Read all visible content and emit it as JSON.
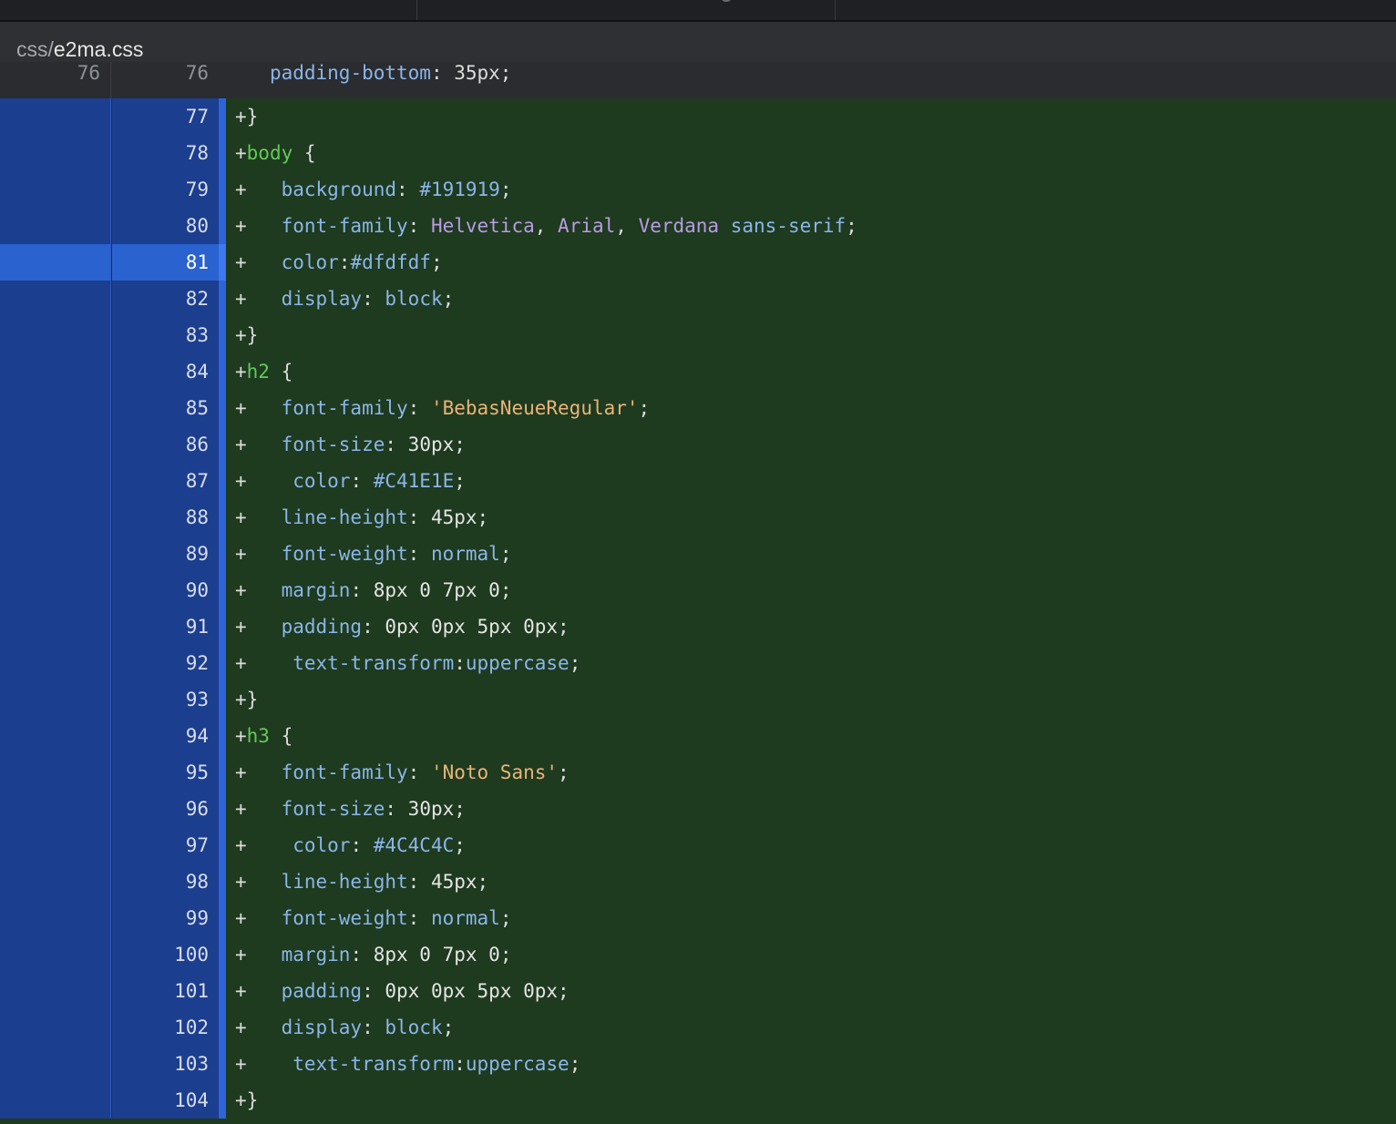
{
  "file": {
    "dir": "css/",
    "name": "e2ma.css"
  },
  "context_line": {
    "old_num": "76",
    "new_num": "76",
    "prefix": "   ",
    "property": "padding-bottom",
    "rest": ": 35px;"
  },
  "lines": [
    {
      "n": "77",
      "segs": [
        [
          "p",
          "+}"
        ]
      ]
    },
    {
      "n": "78",
      "segs": [
        [
          "p",
          "+"
        ],
        [
          "s",
          "body"
        ],
        [
          "p",
          " {"
        ]
      ]
    },
    {
      "n": "79",
      "segs": [
        [
          "p",
          "+   "
        ],
        [
          "k",
          "background"
        ],
        [
          "p",
          ": "
        ],
        [
          "v",
          "#191919"
        ],
        [
          "p",
          ";"
        ]
      ]
    },
    {
      "n": "80",
      "segs": [
        [
          "p",
          "+   "
        ],
        [
          "k",
          "font-family"
        ],
        [
          "p",
          ": "
        ],
        [
          "f",
          "Helvetica"
        ],
        [
          "p",
          ", "
        ],
        [
          "f",
          "Arial"
        ],
        [
          "p",
          ", "
        ],
        [
          "f",
          "Verdana"
        ],
        [
          "p",
          " "
        ],
        [
          "v",
          "sans-serif"
        ],
        [
          "p",
          ";"
        ]
      ]
    },
    {
      "n": "81",
      "sel": true,
      "segs": [
        [
          "p",
          "+   "
        ],
        [
          "k",
          "color"
        ],
        [
          "p",
          ":"
        ],
        [
          "v",
          "#dfdfdf"
        ],
        [
          "p",
          ";"
        ]
      ]
    },
    {
      "n": "82",
      "segs": [
        [
          "p",
          "+   "
        ],
        [
          "k",
          "display"
        ],
        [
          "p",
          ": "
        ],
        [
          "v",
          "block"
        ],
        [
          "p",
          ";"
        ]
      ]
    },
    {
      "n": "83",
      "segs": [
        [
          "p",
          "+}"
        ]
      ]
    },
    {
      "n": "84",
      "segs": [
        [
          "p",
          "+"
        ],
        [
          "s",
          "h2"
        ],
        [
          "p",
          " {"
        ]
      ]
    },
    {
      "n": "85",
      "segs": [
        [
          "p",
          "+   "
        ],
        [
          "k",
          "font-family"
        ],
        [
          "p",
          ": "
        ],
        [
          "str",
          "'BebasNeueRegular'"
        ],
        [
          "p",
          ";"
        ]
      ]
    },
    {
      "n": "86",
      "segs": [
        [
          "p",
          "+   "
        ],
        [
          "k",
          "font-size"
        ],
        [
          "p",
          ": "
        ],
        [
          "n",
          "30px"
        ],
        [
          "p",
          ";"
        ]
      ]
    },
    {
      "n": "87",
      "segs": [
        [
          "p",
          "+    "
        ],
        [
          "k",
          "color"
        ],
        [
          "p",
          ": "
        ],
        [
          "v",
          "#C41E1E"
        ],
        [
          "p",
          ";"
        ]
      ]
    },
    {
      "n": "88",
      "segs": [
        [
          "p",
          "+   "
        ],
        [
          "k",
          "line-height"
        ],
        [
          "p",
          ": "
        ],
        [
          "n",
          "45px"
        ],
        [
          "p",
          ";"
        ]
      ]
    },
    {
      "n": "89",
      "segs": [
        [
          "p",
          "+   "
        ],
        [
          "k",
          "font-weight"
        ],
        [
          "p",
          ": "
        ],
        [
          "v",
          "normal"
        ],
        [
          "p",
          ";"
        ]
      ]
    },
    {
      "n": "90",
      "segs": [
        [
          "p",
          "+   "
        ],
        [
          "k",
          "margin"
        ],
        [
          "p",
          ": "
        ],
        [
          "n",
          "8px 0 7px 0"
        ],
        [
          "p",
          ";"
        ]
      ]
    },
    {
      "n": "91",
      "segs": [
        [
          "p",
          "+   "
        ],
        [
          "k",
          "padding"
        ],
        [
          "p",
          ": "
        ],
        [
          "n",
          "0px 0px 5px 0px"
        ],
        [
          "p",
          ";"
        ]
      ]
    },
    {
      "n": "92",
      "segs": [
        [
          "p",
          "+    "
        ],
        [
          "k",
          "text-transform"
        ],
        [
          "p",
          ":"
        ],
        [
          "v",
          "uppercase"
        ],
        [
          "p",
          ";"
        ]
      ]
    },
    {
      "n": "93",
      "segs": [
        [
          "p",
          "+}"
        ]
      ]
    },
    {
      "n": "94",
      "segs": [
        [
          "p",
          "+"
        ],
        [
          "s",
          "h3"
        ],
        [
          "p",
          " {"
        ]
      ]
    },
    {
      "n": "95",
      "segs": [
        [
          "p",
          "+   "
        ],
        [
          "k",
          "font-family"
        ],
        [
          "p",
          ": "
        ],
        [
          "str",
          "'Noto Sans'"
        ],
        [
          "p",
          ";"
        ]
      ]
    },
    {
      "n": "96",
      "segs": [
        [
          "p",
          "+   "
        ],
        [
          "k",
          "font-size"
        ],
        [
          "p",
          ": "
        ],
        [
          "n",
          "30px"
        ],
        [
          "p",
          ";"
        ]
      ]
    },
    {
      "n": "97",
      "segs": [
        [
          "p",
          "+    "
        ],
        [
          "k",
          "color"
        ],
        [
          "p",
          ": "
        ],
        [
          "v",
          "#4C4C4C"
        ],
        [
          "p",
          ";"
        ]
      ]
    },
    {
      "n": "98",
      "segs": [
        [
          "p",
          "+   "
        ],
        [
          "k",
          "line-height"
        ],
        [
          "p",
          ": "
        ],
        [
          "n",
          "45px"
        ],
        [
          "p",
          ";"
        ]
      ]
    },
    {
      "n": "99",
      "segs": [
        [
          "p",
          "+   "
        ],
        [
          "k",
          "font-weight"
        ],
        [
          "p",
          ": "
        ],
        [
          "v",
          "normal"
        ],
        [
          "p",
          ";"
        ]
      ]
    },
    {
      "n": "100",
      "segs": [
        [
          "p",
          "+   "
        ],
        [
          "k",
          "margin"
        ],
        [
          "p",
          ": "
        ],
        [
          "n",
          "8px 0 7px 0"
        ],
        [
          "p",
          ";"
        ]
      ]
    },
    {
      "n": "101",
      "segs": [
        [
          "p",
          "+   "
        ],
        [
          "k",
          "padding"
        ],
        [
          "p",
          ": "
        ],
        [
          "n",
          "0px 0px 5px 0px"
        ],
        [
          "p",
          ";"
        ]
      ]
    },
    {
      "n": "102",
      "segs": [
        [
          "p",
          "+   "
        ],
        [
          "k",
          "display"
        ],
        [
          "p",
          ": "
        ],
        [
          "v",
          "block"
        ],
        [
          "p",
          ";"
        ]
      ]
    },
    {
      "n": "103",
      "segs": [
        [
          "p",
          "+    "
        ],
        [
          "k",
          "text-transform"
        ],
        [
          "p",
          ":"
        ],
        [
          "v",
          "uppercase"
        ],
        [
          "p",
          ";"
        ]
      ]
    },
    {
      "n": "104",
      "segs": [
        [
          "p",
          "+}"
        ]
      ]
    }
  ],
  "colors": {
    "added_bg": "#1e3a1f",
    "gutter_bg": "#1c3e8f",
    "selected_gutter_bg": "#2a62d0",
    "selector": "#63c95b",
    "property": "#8bb6e8",
    "string": "#e9b478",
    "font_name": "#b99be3"
  }
}
